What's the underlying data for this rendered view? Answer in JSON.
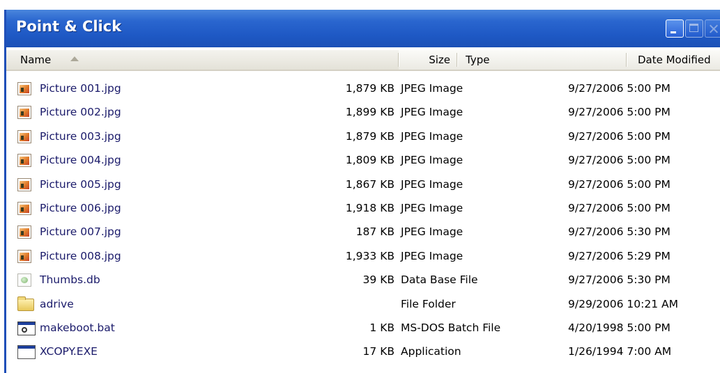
{
  "window": {
    "title": "Point & Click",
    "minimize_icon": "minimize-icon",
    "maximize_icon": "maximize-icon",
    "close_icon": "close-icon"
  },
  "columns": {
    "name": "Name",
    "size": "Size",
    "type": "Type",
    "date": "Date Modified",
    "sort_indicator": "sort-ascending-arrow-icon"
  },
  "files": [
    {
      "name": "Picture 001.jpg",
      "size": "1,879 KB",
      "type": "JPEG Image",
      "date": "9/27/2006 5:00 PM",
      "icon": "jpeg-file-icon"
    },
    {
      "name": "Picture 002.jpg",
      "size": "1,899 KB",
      "type": "JPEG Image",
      "date": "9/27/2006 5:00 PM",
      "icon": "jpeg-file-icon"
    },
    {
      "name": "Picture 003.jpg",
      "size": "1,879 KB",
      "type": "JPEG Image",
      "date": "9/27/2006 5:00 PM",
      "icon": "jpeg-file-icon"
    },
    {
      "name": "Picture 004.jpg",
      "size": "1,809 KB",
      "type": "JPEG Image",
      "date": "9/27/2006 5:00 PM",
      "icon": "jpeg-file-icon"
    },
    {
      "name": "Picture 005.jpg",
      "size": "1,867 KB",
      "type": "JPEG Image",
      "date": "9/27/2006 5:00 PM",
      "icon": "jpeg-file-icon"
    },
    {
      "name": "Picture 006.jpg",
      "size": "1,918 KB",
      "type": "JPEG Image",
      "date": "9/27/2006 5:00 PM",
      "icon": "jpeg-file-icon"
    },
    {
      "name": "Picture 007.jpg",
      "size": "187 KB",
      "type": "JPEG Image",
      "date": "9/27/2006 5:30 PM",
      "icon": "jpeg-file-icon"
    },
    {
      "name": "Picture 008.jpg",
      "size": "1,933 KB",
      "type": "JPEG Image",
      "date": "9/27/2006 5:29 PM",
      "icon": "jpeg-file-icon"
    },
    {
      "name": "Thumbs.db",
      "size": "39 KB",
      "type": "Data Base File",
      "date": "9/27/2006 5:30 PM",
      "icon": "database-file-icon"
    },
    {
      "name": "adrive",
      "size": "",
      "type": "File Folder",
      "date": "9/29/2006 10:21 AM",
      "icon": "folder-icon"
    },
    {
      "name": "makeboot.bat",
      "size": "1 KB",
      "type": "MS-DOS Batch File",
      "date": "4/20/1998 5:00 PM",
      "icon": "batch-file-icon"
    },
    {
      "name": "XCOPY.EXE",
      "size": "17 KB",
      "type": "Application",
      "date": "1/26/1994 7:00 AM",
      "icon": "application-icon"
    }
  ]
}
